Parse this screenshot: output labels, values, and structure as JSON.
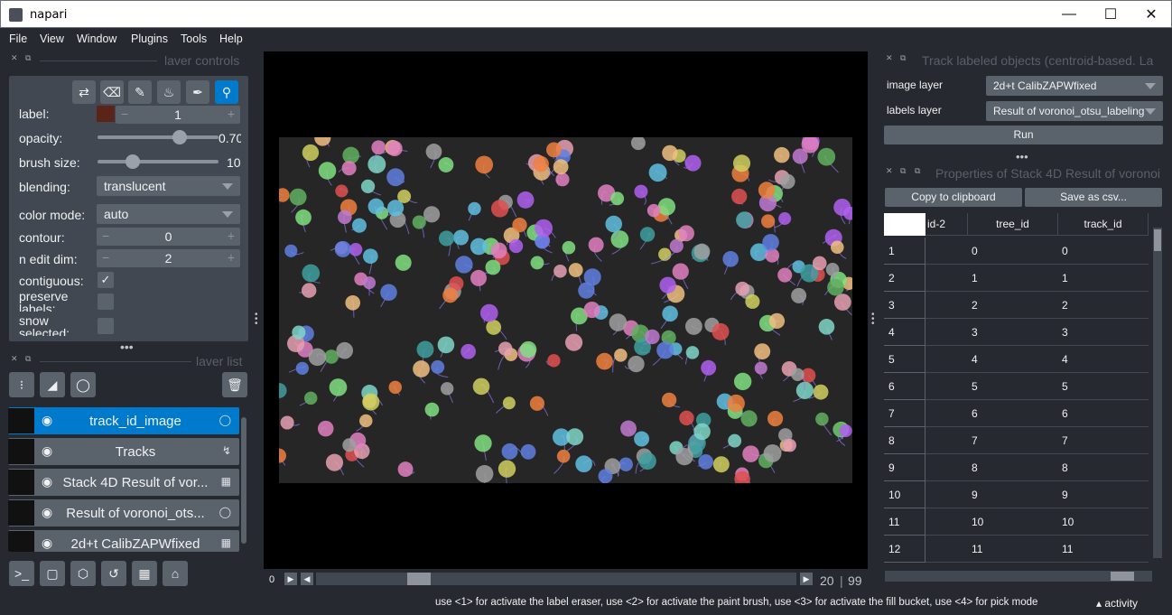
{
  "window": {
    "title": "napari"
  },
  "menu": [
    "File",
    "View",
    "Window",
    "Plugins",
    "Tools",
    "Help"
  ],
  "layer_controls": {
    "header": "laver controls",
    "label": {
      "name": "label:",
      "value": "1",
      "swatch_color": "#5a2418"
    },
    "opacity": {
      "name": "opacity:",
      "value": "0.70",
      "fraction": 0.7
    },
    "brush_size": {
      "name": "brush size:",
      "value": "10",
      "fraction": 0.26
    },
    "blending": {
      "name": "blending:",
      "value": "translucent"
    },
    "color_mode": {
      "name": "color mode:",
      "value": "auto"
    },
    "contour": {
      "name": "contour:",
      "value": "0"
    },
    "n_edit_dim": {
      "name": "n edit dim:",
      "value": "2"
    },
    "contiguous": {
      "name": "contiguous:",
      "checked": true
    },
    "preserve_labels": {
      "name": "preserve\nlabels:",
      "checked": false
    },
    "show_selected": {
      "name": "snow\nselected:",
      "checked": false
    }
  },
  "layer_list": {
    "header": "laver list",
    "layers": [
      {
        "name": "track_id_image",
        "type_icon": "label-icon",
        "selected": true
      },
      {
        "name": "Tracks",
        "type_icon": "tracks-icon",
        "selected": false
      },
      {
        "name": "Stack 4D Result of vor...",
        "type_icon": "image-icon",
        "selected": false
      },
      {
        "name": "Result of voronoi_ots...",
        "type_icon": "label-icon",
        "selected": false
      },
      {
        "name": "2d+t CalibZAPWfixed",
        "type_icon": "image-icon",
        "selected": false
      }
    ]
  },
  "dims": {
    "left_value": "0",
    "current": "20",
    "max": "99",
    "fraction": 0.2
  },
  "track_widget": {
    "title": "Track labeled objects (centroid-based. La",
    "image_layer_label": "image layer",
    "image_layer_value": "2d+t CalibZAPWfixed",
    "labels_layer_label": "labels layer",
    "labels_layer_value": "Result of voronoi_otsu_labeling",
    "run_label": "Run"
  },
  "properties_widget": {
    "title": "Properties of Stack 4D Result of voronoi",
    "copy_label": "Copy to clipboard",
    "save_label": "Save as csv...",
    "columns": [
      "id-2",
      "tree_id",
      "track_id"
    ],
    "rows": [
      {
        "idx": "1",
        "tree_id": "0",
        "track_id": "0"
      },
      {
        "idx": "2",
        "tree_id": "1",
        "track_id": "1"
      },
      {
        "idx": "3",
        "tree_id": "2",
        "track_id": "2"
      },
      {
        "idx": "4",
        "tree_id": "3",
        "track_id": "3"
      },
      {
        "idx": "5",
        "tree_id": "4",
        "track_id": "4"
      },
      {
        "idx": "6",
        "tree_id": "5",
        "track_id": "5"
      },
      {
        "idx": "7",
        "tree_id": "6",
        "track_id": "6"
      },
      {
        "idx": "8",
        "tree_id": "7",
        "track_id": "7"
      },
      {
        "idx": "9",
        "tree_id": "8",
        "track_id": "8"
      },
      {
        "idx": "10",
        "tree_id": "9",
        "track_id": "9"
      },
      {
        "idx": "11",
        "tree_id": "10",
        "track_id": "10"
      },
      {
        "idx": "12",
        "tree_id": "11",
        "track_id": "11"
      }
    ]
  },
  "status": {
    "message": "use <1> for activate the label eraser, use <2> for activate the paint brush, use <3> for activate the fill bucket, use <4> for pick mode",
    "activity": "activity"
  },
  "colors": {
    "accent": "#007acc",
    "bg": "#262930",
    "panel": "#414851",
    "control": "#5a626c"
  }
}
